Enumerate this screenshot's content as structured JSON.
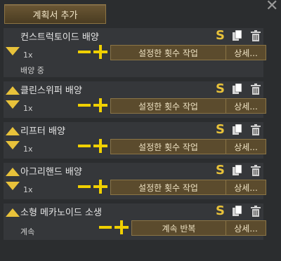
{
  "header": {
    "add_bill_label": "계획서 추가"
  },
  "bills": [
    {
      "title": "컨스트럭토이드 배양",
      "count": "1x",
      "status": "배양 중",
      "mode": "설정한 횟수 작업",
      "details": "상세..."
    },
    {
      "title": "클린스위퍼 배양",
      "count": "1x",
      "status": "",
      "mode": "설정한 횟수 작업",
      "details": "상세..."
    },
    {
      "title": "리프터 배양",
      "count": "1x",
      "status": "",
      "mode": "설정한 횟수 작업",
      "details": "상세..."
    },
    {
      "title": "아그리핸드 배양",
      "count": "1x",
      "status": "",
      "mode": "설정한 횟수 작업",
      "details": "상세..."
    },
    {
      "title": "소형 메카노이드 소생",
      "count": "계속",
      "status": "",
      "mode": "계속 반복",
      "details": "상세..."
    }
  ],
  "icons": {
    "s_label": "S"
  },
  "colors": {
    "accent": "#e8c23a",
    "button_bg": "#5b4b2d",
    "panel_bg": "#35373a"
  }
}
